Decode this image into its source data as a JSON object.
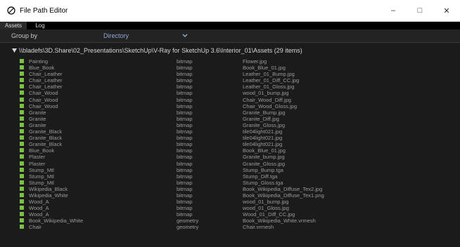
{
  "window": {
    "title": "File Path Editor",
    "controls": {
      "minimize": "–",
      "maximize": "□",
      "close": "✕"
    }
  },
  "tabs": [
    {
      "label": "Assets",
      "active": true
    },
    {
      "label": "Log",
      "active": false
    }
  ],
  "group_by": {
    "label": "Group by",
    "value": "Directory"
  },
  "folder": {
    "path": "\\\\bladefs\\3D.Share\\02_Presentations\\SketchUp\\V-Ray for SketchUp 3.6\\Interior_01\\Assets (29 items)"
  },
  "colors": {
    "accent_green": "#7cc242",
    "directory_text": "#8fa7d8"
  },
  "rows": [
    {
      "name": "Painting",
      "type": "bitmap",
      "file": "Flower.jpg"
    },
    {
      "name": "Blue_Book",
      "type": "bitmap",
      "file": "Book_Blue_01.jpg"
    },
    {
      "name": "Chair_Leather",
      "type": "bitmap",
      "file": "Leather_01_Bump.jpg"
    },
    {
      "name": "Chair_Leather",
      "type": "bitmap",
      "file": "Leather_01_Diff_CC.jpg"
    },
    {
      "name": "Chair_Leather",
      "type": "bitmap",
      "file": "Leather_01_Gloss.jpg"
    },
    {
      "name": "Chair_Wood",
      "type": "bitmap",
      "file": "wood_01_bump.jpg"
    },
    {
      "name": "Chair_Wood",
      "type": "bitmap",
      "file": "Chair_Wood_Diff.jpg"
    },
    {
      "name": "Chair_Wood",
      "type": "bitmap",
      "file": "Chair_Wood_Gloss.jpg"
    },
    {
      "name": "Granite",
      "type": "bitmap",
      "file": "Granite_Bump.jpg"
    },
    {
      "name": "Granite",
      "type": "bitmap",
      "file": "Granite_Diff.jpg"
    },
    {
      "name": "Granite",
      "type": "bitmap",
      "file": "Granite_Gloss.jpg"
    },
    {
      "name": "Granite_Black",
      "type": "bitmap",
      "file": "tile04light021.jpg"
    },
    {
      "name": "Granite_Black",
      "type": "bitmap",
      "file": "tile04light021.jpg"
    },
    {
      "name": "Granite_Black",
      "type": "bitmap",
      "file": "tile04light021.jpg"
    },
    {
      "name": "Blue_Book",
      "type": "bitmap",
      "file": "Book_Blue_01.jpg"
    },
    {
      "name": "Plaster",
      "type": "bitmap",
      "file": "Granite_bump.jpg"
    },
    {
      "name": "Plaster",
      "type": "bitmap",
      "file": "Granite_Gloss.jpg"
    },
    {
      "name": "Stump_Mtl",
      "type": "bitmap",
      "file": "Stump_Bump.tga"
    },
    {
      "name": "Stump_Mtl",
      "type": "bitmap",
      "file": "Stump_Diff.tga"
    },
    {
      "name": "Stump_Mtl",
      "type": "bitmap",
      "file": "Stump_Gloss.tga"
    },
    {
      "name": "Wikipedia_Black",
      "type": "bitmap",
      "file": "Book_Wikipedia_Diffuse_Tex2.jpg"
    },
    {
      "name": "Wikipedia_White",
      "type": "bitmap",
      "file": "Book_Wikipedia_Diffuse_Tex1.png"
    },
    {
      "name": "Wood_A",
      "type": "bitmap",
      "file": "wood_01_bump.jpg"
    },
    {
      "name": "Wood_A",
      "type": "bitmap",
      "file": "wood_01_Gloss.jpg"
    },
    {
      "name": "Wood_A",
      "type": "bitmap",
      "file": "Wood_01_Diff_CC.jpg"
    },
    {
      "name": "Book_Wikipedia_White",
      "type": "geometry",
      "file": "Book_Wikipedia_White.vrmesh"
    },
    {
      "name": "Chair",
      "type": "geometry",
      "file": "Chair.vrmesh"
    }
  ]
}
